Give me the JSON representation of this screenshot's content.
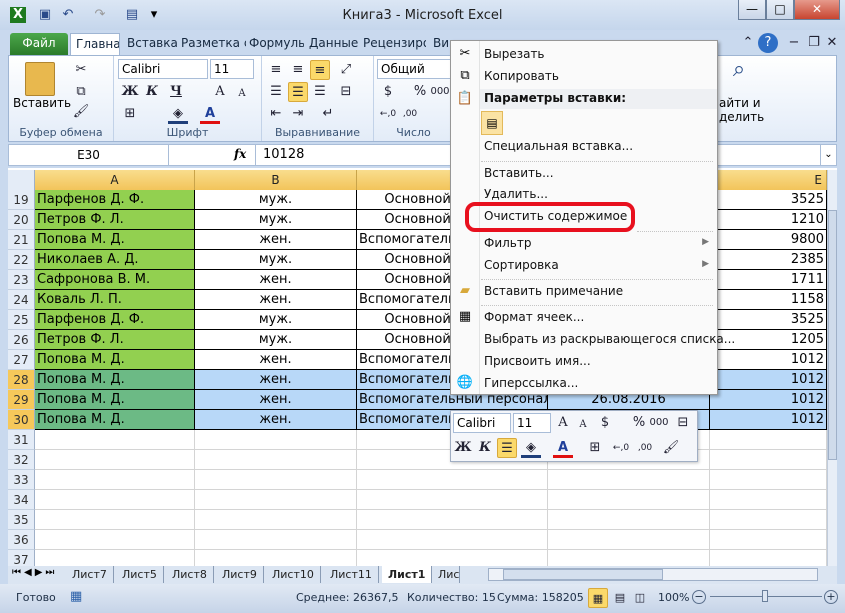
{
  "window": {
    "title": "Книга3  -  Microsoft Excel"
  },
  "ribbon_tabs": [
    "Файл",
    "Главная",
    "Вставка",
    "Разметка с",
    "Формулы",
    "Данные",
    "Рецензиро",
    "Ви"
  ],
  "ribbon": {
    "paste_label": "Вставить",
    "clipboard_group": "Буфер обмена",
    "font_group": "Шрифт",
    "align_group": "Выравнивание",
    "number_group": "Число",
    "font_name": "Calibri",
    "font_size": "11",
    "number_format": "Общий",
    "bold": "Ж",
    "italic": "К",
    "underline": "Ч",
    "find_label_1": "айти и",
    "find_label_2": "делить"
  },
  "formula_bar": {
    "name_box": "E30",
    "fx": "fx",
    "value": "10128"
  },
  "columns": [
    "A",
    "B",
    "",
    "",
    "E"
  ],
  "rows": [
    {
      "n": "19",
      "a": "Парфенов Д. Ф.",
      "b": "муж.",
      "c": "Основной персонал",
      "d": "",
      "e": "3525"
    },
    {
      "n": "20",
      "a": "Петров Ф. Л.",
      "b": "муж.",
      "c": "Основной персонал",
      "d": "",
      "e": "1210"
    },
    {
      "n": "21",
      "a": "Попова М. Д.",
      "b": "жен.",
      "c": "Вспомогательный персонал",
      "d": "",
      "e": "9800"
    },
    {
      "n": "22",
      "a": "Николаев А. Д.",
      "b": "муж.",
      "c": "Основной персонал",
      "d": "",
      "e": "2385"
    },
    {
      "n": "23",
      "a": "Сафронова В. М.",
      "b": "жен.",
      "c": "Основной персонал",
      "d": "",
      "e": "1711"
    },
    {
      "n": "24",
      "a": "Коваль Л. П.",
      "b": "жен.",
      "c": "Вспомогательный персонал",
      "d": "",
      "e": "1158"
    },
    {
      "n": "25",
      "a": "Парфенов Д. Ф.",
      "b": "муж.",
      "c": "Основной персонал",
      "d": "",
      "e": "3525"
    },
    {
      "n": "26",
      "a": "Петров Ф. Л.",
      "b": "муж.",
      "c": "Основной персонал",
      "d": "",
      "e": "1205"
    },
    {
      "n": "27",
      "a": "Попова М. Д.",
      "b": "жен.",
      "c": "Вспомогательный персонал",
      "d": "",
      "e": "1012"
    },
    {
      "n": "28",
      "a": "Попова М. Д.",
      "b": "жен.",
      "c": "Вспомогательный персонал",
      "d": "",
      "e": "1012"
    },
    {
      "n": "29",
      "a": "Попова М. Д.",
      "b": "жен.",
      "c": "Вспомогательный персонал",
      "d": "26.08.2016",
      "e": "1012"
    },
    {
      "n": "30",
      "a": "Попова М. Д.",
      "b": "жен.",
      "c": "Вспомогательный персонал",
      "d": "",
      "e": "1012"
    }
  ],
  "empty_rows": [
    "31",
    "32",
    "33",
    "34",
    "35",
    "36",
    "37"
  ],
  "context_menu": {
    "items": [
      "Вырезать",
      "Копировать",
      "Параметры вставки:",
      "Специальная вставка...",
      "Вставить...",
      "Удалить...",
      "Очистить содержимое",
      "Фильтр",
      "Сортировка",
      "Вставить примечание",
      "Формат ячеек...",
      "Выбрать из раскрывающегося списка...",
      "Присвоить имя...",
      "Гиперссылка..."
    ],
    "highlight_color": "#e8101e"
  },
  "mini_toolbar": {
    "font": "Calibri",
    "size": "11"
  },
  "sheet_tabs": [
    "Лист7",
    "Лист5",
    "Лист8",
    "Лист9",
    "Лист10",
    "Лист11",
    "Лист1",
    "Лис"
  ],
  "active_sheet": "Лист1",
  "status": {
    "ready": "Готово",
    "average": "Среднее: 26367,5",
    "count": "Количество: 15",
    "sum": "Сумма: 158205",
    "zoom": "100%"
  },
  "colors": {
    "green_fill": "#92d050",
    "selection": "#b8d8f8",
    "header_orange": "#f6c85a"
  }
}
